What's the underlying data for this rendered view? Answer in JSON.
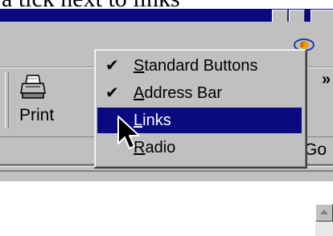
{
  "caption": "a tick next to links",
  "toolbar": {
    "print_label": "Print",
    "chevron": "»",
    "go_label": "Go"
  },
  "context_menu": {
    "items": [
      {
        "label": "Standard Buttons",
        "checked": true,
        "mnemonic": "S"
      },
      {
        "label": "Address Bar",
        "checked": true,
        "mnemonic": "A"
      },
      {
        "label": "Links",
        "checked": false,
        "mnemonic": "L",
        "highlighted": true
      },
      {
        "label": "Radio",
        "checked": false,
        "mnemonic": "R"
      }
    ]
  },
  "icons": [
    "print-icon",
    "logo-icon",
    "check-icon",
    "arrow-cursor-icon",
    "scroll-up-icon"
  ],
  "colors": {
    "titlebar": "#0a0a80",
    "highlight": "#0a0a80",
    "face": "#c0c0c0"
  }
}
